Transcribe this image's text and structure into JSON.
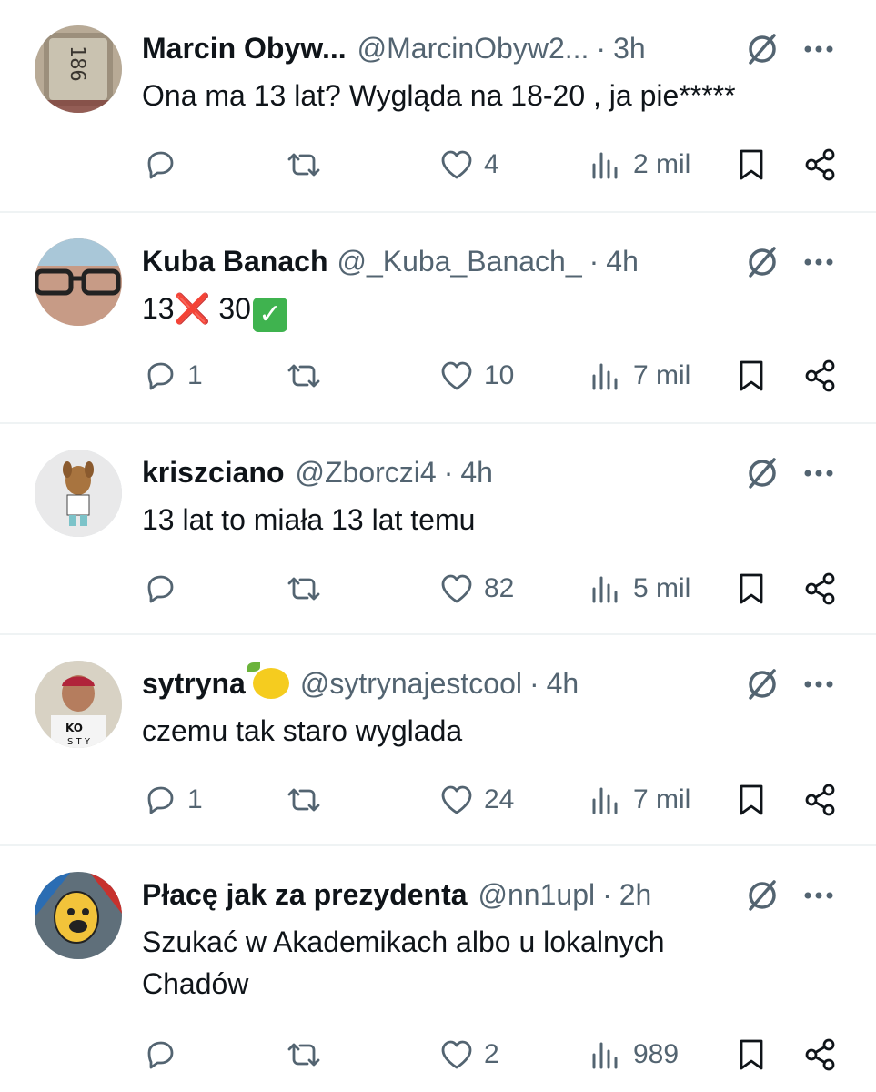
{
  "tweets": [
    {
      "name": "Marcin Obyw...",
      "handle": "@MarcinObyw2...",
      "time": "3h",
      "text": "Ona ma 13 lat? Wygląda na 18-20 , ja pie*****",
      "replies": "",
      "retweets": "",
      "likes": "4",
      "views": "2 mil",
      "avatar": "watch-avatar"
    },
    {
      "name": "Kuba Banach",
      "handle": "@_Kuba_Banach_",
      "time": "4h",
      "text_parts": [
        "13",
        "❌",
        " 30",
        "✓"
      ],
      "replies": "1",
      "retweets": "",
      "likes": "10",
      "views": "7 mil",
      "avatar": "glasses-face-avatar"
    },
    {
      "name": "kriszciano",
      "handle": "@Zborczi4",
      "time": "4h",
      "text": "13 lat to miała 13 lat temu",
      "replies": "",
      "retweets": "",
      "likes": "82",
      "views": "5 mil",
      "avatar": "cartoon-dog-avatar"
    },
    {
      "name": "sytryna",
      "handle": "@sytrynajestcool",
      "time": "4h",
      "text": "czemu tak staro wyglada",
      "replies": "1",
      "retweets": "",
      "likes": "24",
      "views": "7 mil",
      "avatar": "person-photo-avatar",
      "avatar_text": "KO",
      "avatar_text2": "S T Y"
    },
    {
      "name": "Płacę jak za prezydenta",
      "handle": "@nn1upl",
      "time": "2h",
      "text": "Szukać w Akademikach albo u lokalnych Chadów",
      "replies": "",
      "retweets": "",
      "likes": "2",
      "views": "989",
      "avatar": "yellow-dog-avatar"
    }
  ],
  "separator": "·",
  "colors": {
    "text": "#0f1419",
    "secondary": "#536471",
    "divider": "#eff3f4",
    "x_emoji": "#e0242b",
    "check_emoji": "#3fb34f"
  },
  "icons": [
    "reply-icon",
    "retweet-icon",
    "like-icon",
    "views-icon",
    "bookmark-icon",
    "share-icon",
    "grok-icon",
    "more-icon"
  ]
}
